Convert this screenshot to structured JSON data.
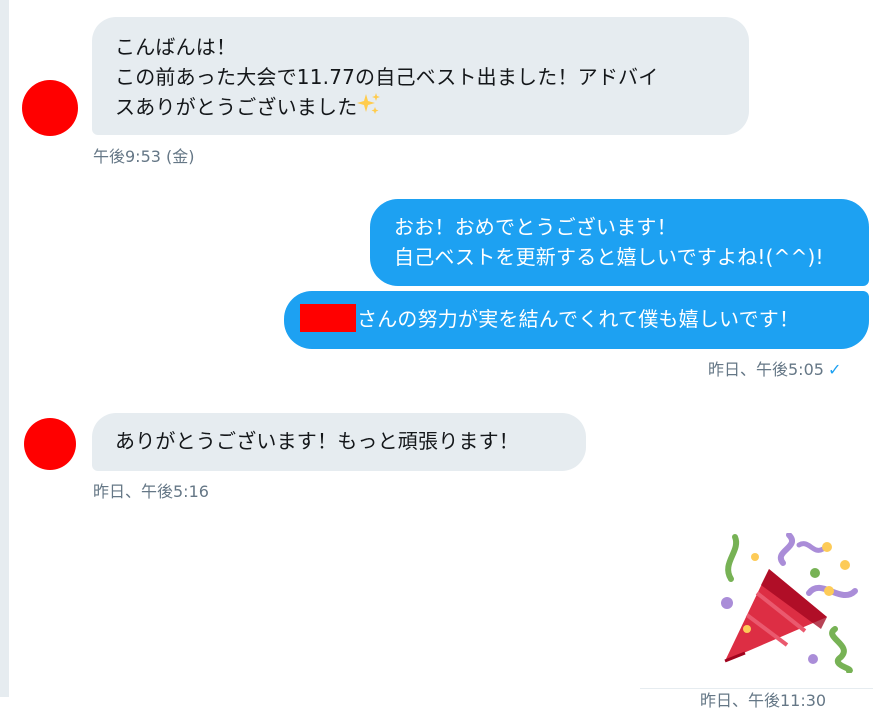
{
  "messages": [
    {
      "lines": [
        "こんばんは！",
        "この前あった大会で11.77の自己ベスト出ました！アドバイ",
        "スありがとうございました"
      ],
      "emoji": "sparkles-icon",
      "timestamp": "午後9:53 (金)"
    },
    {
      "lines": [
        "おお！おめでとうございます！",
        "自己ベストを更新すると嬉しいですよね!(^^)!"
      ]
    },
    {
      "text": "さんの努力が実を結んでくれて僕も嬉しいです！",
      "timestamp": "昨日、午後5:05",
      "read_check": "✓"
    },
    {
      "text": "ありがとうございます！もっと頑張ります！",
      "timestamp": "昨日、午後5:16"
    },
    {
      "emoji": "party-popper-icon",
      "timestamp": "昨日、午後11:30"
    }
  ],
  "colors": {
    "incoming_bubble": "#e6ecf0",
    "outgoing_bubble": "#1da1f2",
    "avatar_redacted": "#ff0000",
    "timestamp": "#657786"
  }
}
